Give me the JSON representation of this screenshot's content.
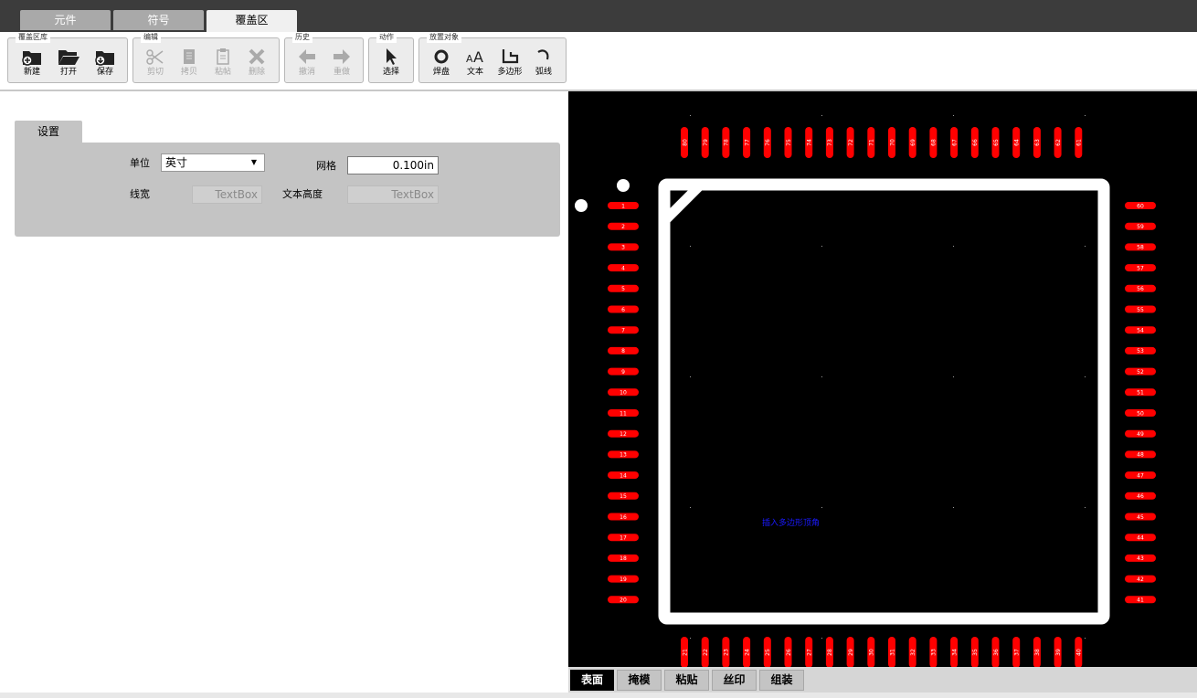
{
  "main_tabs": [
    {
      "label": "元件"
    },
    {
      "label": "符号"
    },
    {
      "label": "覆盖区"
    }
  ],
  "toolbar": {
    "groups": [
      {
        "title": "覆盖区库",
        "buttons": [
          {
            "label": "新建",
            "icon": "new-folder-icon"
          },
          {
            "label": "打开",
            "icon": "open-folder-icon"
          },
          {
            "label": "保存",
            "icon": "save-folder-icon"
          }
        ]
      },
      {
        "title": "编辑",
        "buttons": [
          {
            "label": "剪切",
            "icon": "scissors-icon"
          },
          {
            "label": "拷贝",
            "icon": "copy-icon"
          },
          {
            "label": "粘帖",
            "icon": "paste-icon"
          },
          {
            "label": "删除",
            "icon": "delete-x-icon"
          }
        ]
      },
      {
        "title": "历史",
        "buttons": [
          {
            "label": "撤消",
            "icon": "arrow-left-icon"
          },
          {
            "label": "重做",
            "icon": "arrow-right-icon"
          }
        ]
      },
      {
        "title": "动作",
        "buttons": [
          {
            "label": "选择",
            "icon": "cursor-icon"
          }
        ]
      },
      {
        "title": "放置对象",
        "buttons": [
          {
            "label": "焊盘",
            "icon": "pad-circle-icon"
          },
          {
            "label": "文本",
            "icon": "text-aa-icon"
          },
          {
            "label": "多边形",
            "icon": "polygon-icon"
          },
          {
            "label": "弧线",
            "icon": "arc-icon"
          }
        ]
      }
    ]
  },
  "settings": {
    "tab_label": "设置",
    "unit_label": "单位",
    "unit_value": "英寸",
    "grid_label": "网格",
    "grid_value": "0.100in",
    "line_width_label": "线宽",
    "line_width_placeholder": "TextBox",
    "text_height_label": "文本高度",
    "text_height_placeholder": "TextBox"
  },
  "canvas": {
    "annotation": "插入多边形顶角",
    "left_pins": [
      "1",
      "2",
      "3",
      "4",
      "5",
      "6",
      "7",
      "8",
      "9",
      "10",
      "11",
      "12",
      "13",
      "14",
      "15",
      "16",
      "17",
      "18",
      "19",
      "20"
    ],
    "right_pins": [
      "60",
      "59",
      "58",
      "57",
      "56",
      "55",
      "54",
      "53",
      "52",
      "51",
      "50",
      "49",
      "48",
      "47",
      "46",
      "45",
      "44",
      "43",
      "42",
      "41"
    ],
    "top_pins": [
      "80",
      "79",
      "78",
      "77",
      "76",
      "75",
      "74",
      "73",
      "72",
      "71",
      "70",
      "69",
      "68",
      "67",
      "66",
      "65",
      "64",
      "63",
      "62",
      "61"
    ],
    "bottom_pins": [
      "21",
      "22",
      "23",
      "24",
      "25",
      "26",
      "27",
      "28",
      "29",
      "30",
      "31",
      "32",
      "33",
      "34",
      "35",
      "36",
      "37",
      "38",
      "39",
      "40"
    ],
    "colors": {
      "pad": "#ff0000",
      "outline": "#ffffff",
      "background": "#000000",
      "annotation": "#1a1aff"
    }
  },
  "layer_tabs": [
    {
      "label": "表面"
    },
    {
      "label": "掩模"
    },
    {
      "label": "粘贴"
    },
    {
      "label": "丝印"
    },
    {
      "label": "组装"
    }
  ]
}
